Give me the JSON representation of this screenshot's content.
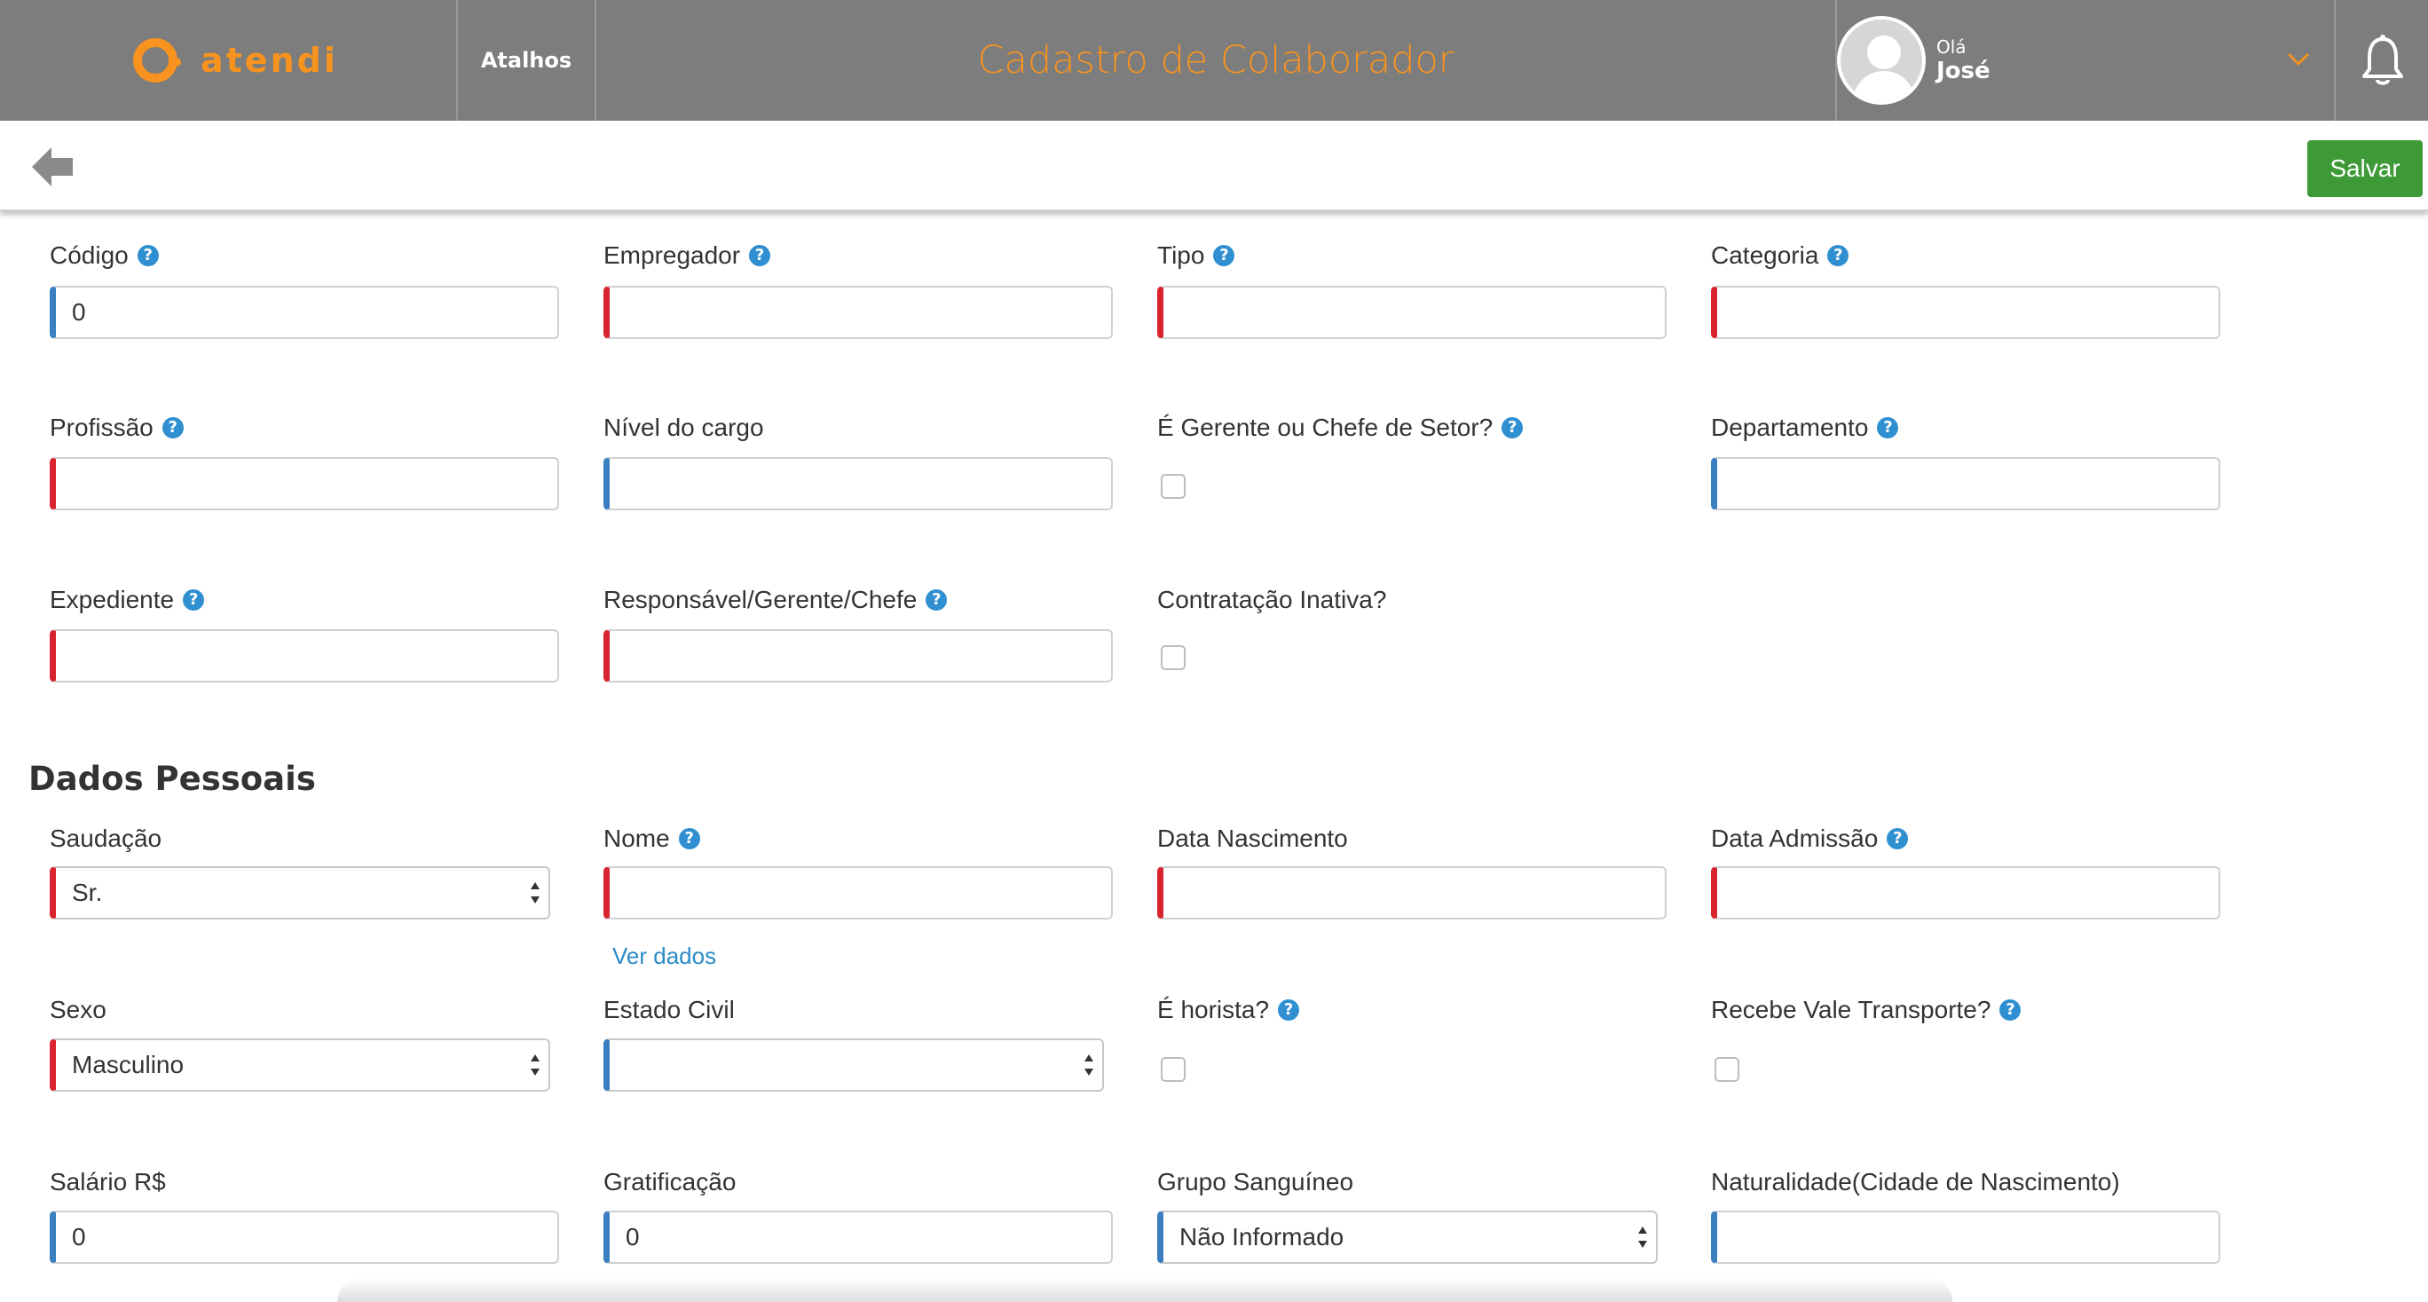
{
  "header": {
    "logo_text": "atendi",
    "shortcuts_label": "Atalhos",
    "page_title": "Cadastro de Colaborador",
    "user_greeting": "Olá",
    "user_name": "José"
  },
  "toolbar": {
    "save_label": "Salvar"
  },
  "form": {
    "codigo": {
      "label": "Código",
      "value": "0"
    },
    "empregador": {
      "label": "Empregador",
      "value": ""
    },
    "tipo": {
      "label": "Tipo",
      "value": ""
    },
    "categoria": {
      "label": "Categoria",
      "value": ""
    },
    "profissao": {
      "label": "Profissão",
      "value": ""
    },
    "nivel_cargo": {
      "label": "Nível do cargo",
      "value": ""
    },
    "gerente": {
      "label": "É Gerente ou Chefe de Setor?",
      "checked": false
    },
    "departamento": {
      "label": "Departamento",
      "value": ""
    },
    "expediente": {
      "label": "Expediente",
      "value": ""
    },
    "responsavel": {
      "label": "Responsável/Gerente/Chefe",
      "value": ""
    },
    "contratacao_inativa": {
      "label": "Contratação Inativa?",
      "checked": false
    }
  },
  "dados_pessoais": {
    "title": "Dados Pessoais",
    "saudacao": {
      "label": "Saudação",
      "value": "Sr."
    },
    "nome": {
      "label": "Nome",
      "value": "",
      "link": "Ver dados"
    },
    "data_nascimento": {
      "label": "Data Nascimento",
      "value": ""
    },
    "data_admissao": {
      "label": "Data Admissão",
      "value": ""
    },
    "sexo": {
      "label": "Sexo",
      "value": "Masculino"
    },
    "estado_civil": {
      "label": "Estado Civil",
      "value": ""
    },
    "horista": {
      "label": "É horista?",
      "checked": false
    },
    "vale_transporte": {
      "label": "Recebe Vale Transporte?",
      "checked": false
    },
    "salario": {
      "label": "Salário R$",
      "value": "0"
    },
    "gratificacao": {
      "label": "Gratificação",
      "value": "0"
    },
    "grupo_sanguineo": {
      "label": "Grupo Sanguíneo",
      "value": "Não Informado"
    },
    "naturalidade": {
      "label": "Naturalidade(Cidade de Nascimento)",
      "value": ""
    }
  },
  "icons": {
    "help": "?",
    "colors": {
      "brand": "#f7931e",
      "required": "#d9232e",
      "optional": "#3a7fc0",
      "help": "#2f8fd0",
      "save": "#3d9a37",
      "header": "#7d7d7d"
    }
  }
}
